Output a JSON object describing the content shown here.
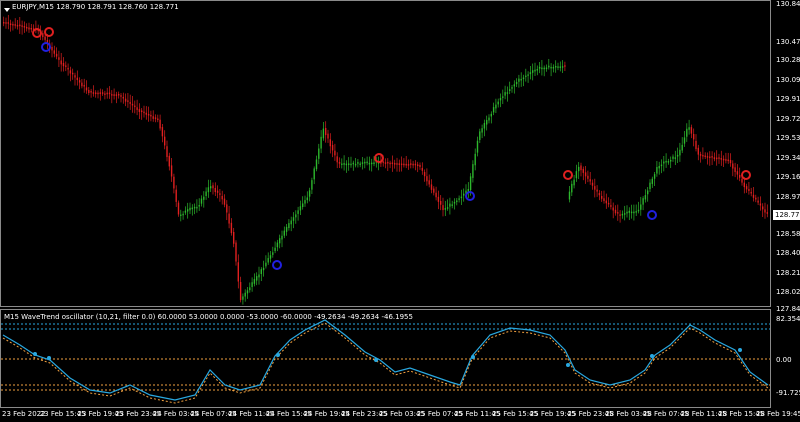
{
  "symbol_label": "EURJPY,M15  128.790 128.791 128.760 128.771",
  "oscillator_label": "M15 WaveTrend oscillator (10,21, filter 0.0) 60.0000 53.0000 0.0000 -53.0000 -60.0000 -49.2634 -49.2634 -46.1955",
  "price_axis": [
    "130.845",
    "130.470",
    "130.285",
    "130.095",
    "129.910",
    "129.720",
    "129.535",
    "129.345",
    "129.160",
    "128.970",
    "128.585",
    "128.400",
    "128.210",
    "128.025",
    "127.845"
  ],
  "current_price": "128.771",
  "osc_axis": [
    "82.3547",
    "0.00",
    "-91.7251"
  ],
  "time_axis": [
    "23 Feb 2022",
    "23 Feb 15:45",
    "23 Feb 19:45",
    "23 Feb 23:45",
    "24 Feb 03:45",
    "24 Feb 07:45",
    "24 Feb 11:45",
    "24 Feb 15:45",
    "24 Feb 19:45",
    "24 Feb 23:45",
    "25 Feb 03:45",
    "25 Feb 07:45",
    "25 Feb 11:45",
    "25 Feb 15:45",
    "25 Feb 19:45",
    "25 Feb 23:45",
    "28 Feb 03:45",
    "28 Feb 07:45",
    "28 Feb 11:45",
    "28 Feb 15:45",
    "28 Feb 19:45"
  ],
  "colors": {
    "bull": "#2db82d",
    "bear": "#e02020",
    "wave_up": "#29a8e0",
    "wave_down": "#f0a040",
    "signal_up": "#e02020",
    "signal_down": "#2020e0"
  }
}
